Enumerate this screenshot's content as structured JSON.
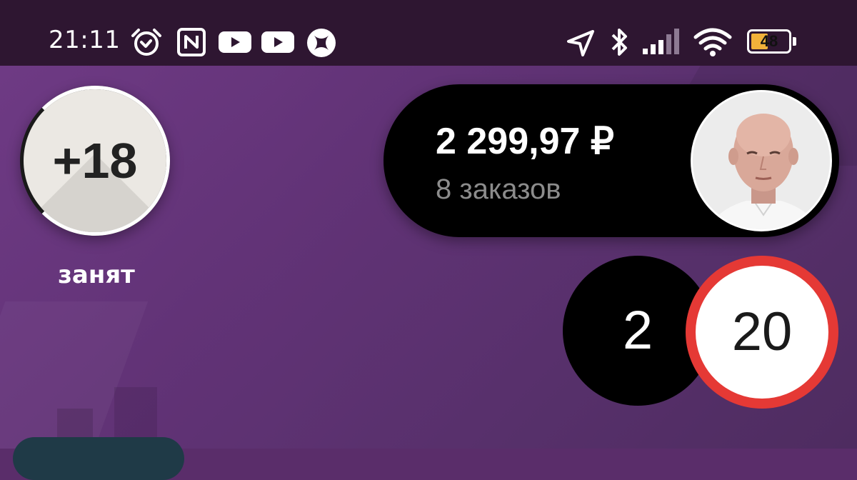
{
  "status_bar": {
    "time": "21:11",
    "battery_level": "48",
    "icons": [
      "alarm-icon",
      "nfc-icon",
      "youtube-icon",
      "youtube-icon",
      "app-icon",
      "location-arrow-icon",
      "bluetooth-icon",
      "signal-icon",
      "wifi-icon",
      "battery-icon"
    ]
  },
  "priority": {
    "value": "+18",
    "status": "занят"
  },
  "balance": {
    "amount": "2 299,97 ₽",
    "orders": "8 заказов"
  },
  "speed": {
    "current": "2",
    "limit": "20"
  },
  "colors": {
    "statusbar_bg": "#2e1631",
    "map_bg": "#623377",
    "speed_limit_ring": "#e53935",
    "pill_bg": "#000000"
  }
}
